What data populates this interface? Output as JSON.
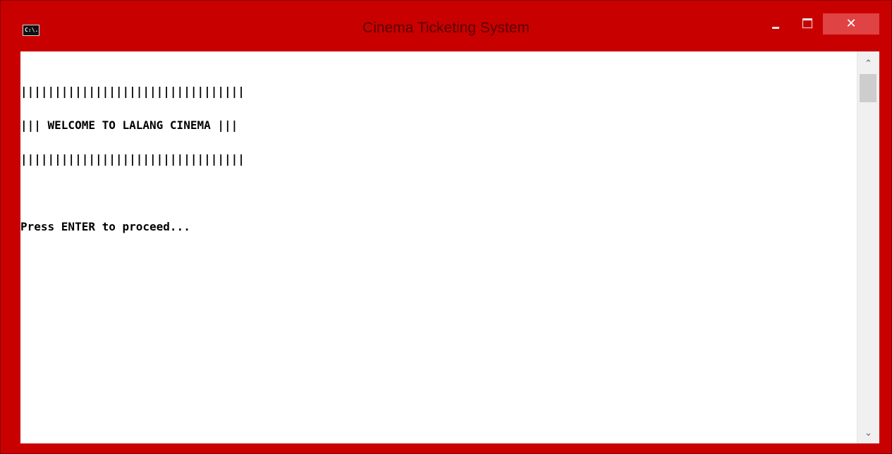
{
  "window": {
    "title": "Cinema Ticketing System",
    "icon": "console-icon",
    "icon_text": "C:\\."
  },
  "console": {
    "lines": [
      "|||||||||||||||||||||||||||||||||",
      "||| WELCOME TO LALANG CINEMA |||",
      "|||||||||||||||||||||||||||||||||",
      "",
      "Press ENTER to proceed..."
    ]
  },
  "controls": {
    "close_glyph": "✕"
  },
  "scrollbar": {
    "up_glyph": "⌃",
    "down_glyph": "⌄"
  },
  "colors": {
    "frame": "#c90000",
    "close_button": "#e04343",
    "console_background": "#ffffff",
    "console_text": "#000000"
  }
}
